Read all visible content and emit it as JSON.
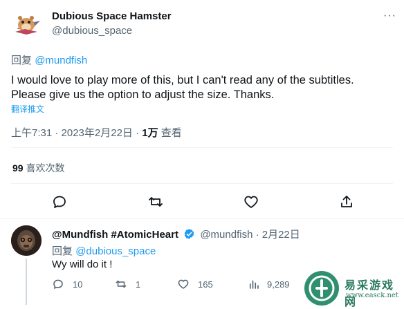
{
  "tweet": {
    "display_name": "Dubious Space Hamster",
    "handle": "@dubious_space",
    "reply_prefix": "回复",
    "reply_to": "@mundfish",
    "text_line1": "I would love to play more of this, but I can't read any of the subtitles.",
    "text_line2": "Please give us the option to adjust the size. Thanks.",
    "translate_label": "翻译推文",
    "time": "上午7:31 · 2023年2月22日 · ",
    "views_count": "1万",
    "views_label": " 查看",
    "likes_count": "99",
    "likes_label": " 喜欢次数",
    "more_label": "···"
  },
  "reply": {
    "display_name": "@Mundfish #AtomicHeart",
    "handle_time": "@mundfish · 2月22日",
    "reply_prefix": "回复",
    "reply_to": "@dubious_space",
    "text": "Wy will do it !",
    "stats": {
      "replies": "10",
      "retweets": "1",
      "likes": "165",
      "views": "9,289"
    }
  },
  "watermark": {
    "text": "易采游戏网",
    "url": "www.easck.net"
  },
  "colors": {
    "accent": "#1d9bf0",
    "secondary_text": "#536471",
    "primary_text": "#0f1419",
    "divider": "#eff3f4"
  }
}
